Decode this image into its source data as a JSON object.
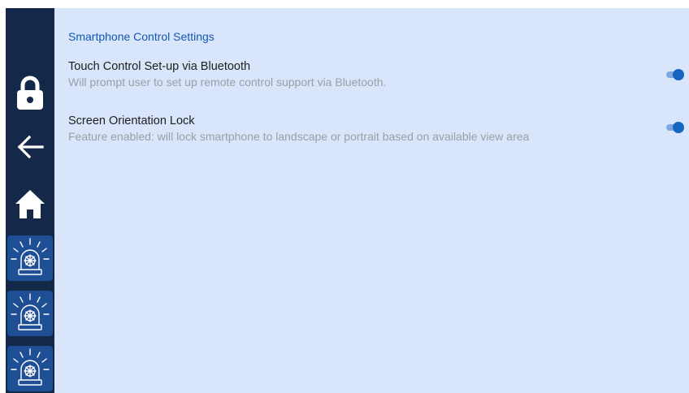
{
  "sidebar": {
    "buttons": [
      {
        "icon": "lock-icon"
      },
      {
        "icon": "back-arrow-icon"
      },
      {
        "icon": "home-icon"
      },
      {
        "icon": "alarm-beacon-icon"
      },
      {
        "icon": "alarm-beacon-icon"
      },
      {
        "icon": "alarm-beacon-icon"
      }
    ]
  },
  "settings_page": {
    "section_title": "Smartphone Control Settings",
    "items": [
      {
        "title": "Touch Control Set-up via Bluetooth",
        "description": "Will prompt user to set up remote control support via Bluetooth.",
        "enabled": true
      },
      {
        "title": "Screen Orientation Lock",
        "description": "Feature enabled: will lock smartphone to landscape or portrait based on available view area",
        "enabled": true
      }
    ]
  },
  "colors": {
    "sidebar_bg": "#14284a",
    "alarm_button_bg": "#1e4f95",
    "content_bg": "#d8e5fa",
    "accent": "#1565c0",
    "section_title": "#1558b0"
  }
}
